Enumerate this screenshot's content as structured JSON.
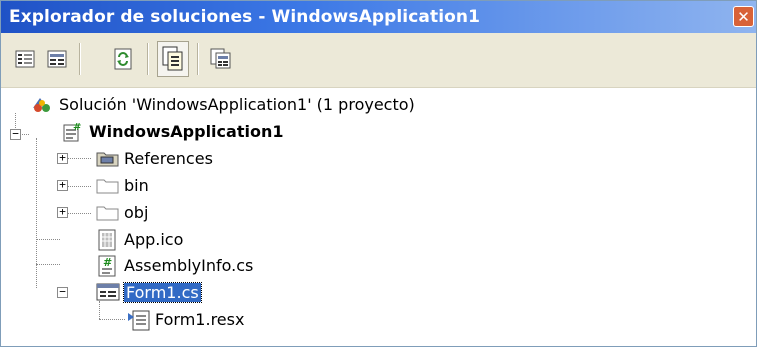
{
  "window": {
    "title": "Explorador de soluciones - WindowsApplication1",
    "close_glyph": "✕"
  },
  "toolbar": {
    "buttons": [
      {
        "name": "properties-icon"
      },
      {
        "name": "show-all-files-icon"
      },
      {
        "name": "refresh-icon"
      },
      {
        "name": "view-code-icon",
        "pressed": true
      },
      {
        "name": "view-designer-icon"
      }
    ]
  },
  "tree": {
    "solution": {
      "label": "Solución 'WindowsApplication1' (1 proyecto)",
      "icon": "solution-icon"
    },
    "project": {
      "label": "WindowsApplication1",
      "icon": "csharp-project-icon",
      "expander": "−"
    },
    "items": [
      {
        "label": "References",
        "icon": "references-folder-icon",
        "expander": "+"
      },
      {
        "label": "bin",
        "icon": "folder-icon",
        "expander": "+"
      },
      {
        "label": "obj",
        "icon": "folder-icon",
        "expander": "+"
      },
      {
        "label": "App.ico",
        "icon": "ico-file-icon"
      },
      {
        "label": "AssemblyInfo.cs",
        "icon": "cs-file-icon"
      },
      {
        "label": "Form1.cs",
        "icon": "form-file-icon",
        "expander": "−",
        "selected": true
      },
      {
        "label": "Form1.resx",
        "icon": "resx-file-icon"
      }
    ]
  }
}
